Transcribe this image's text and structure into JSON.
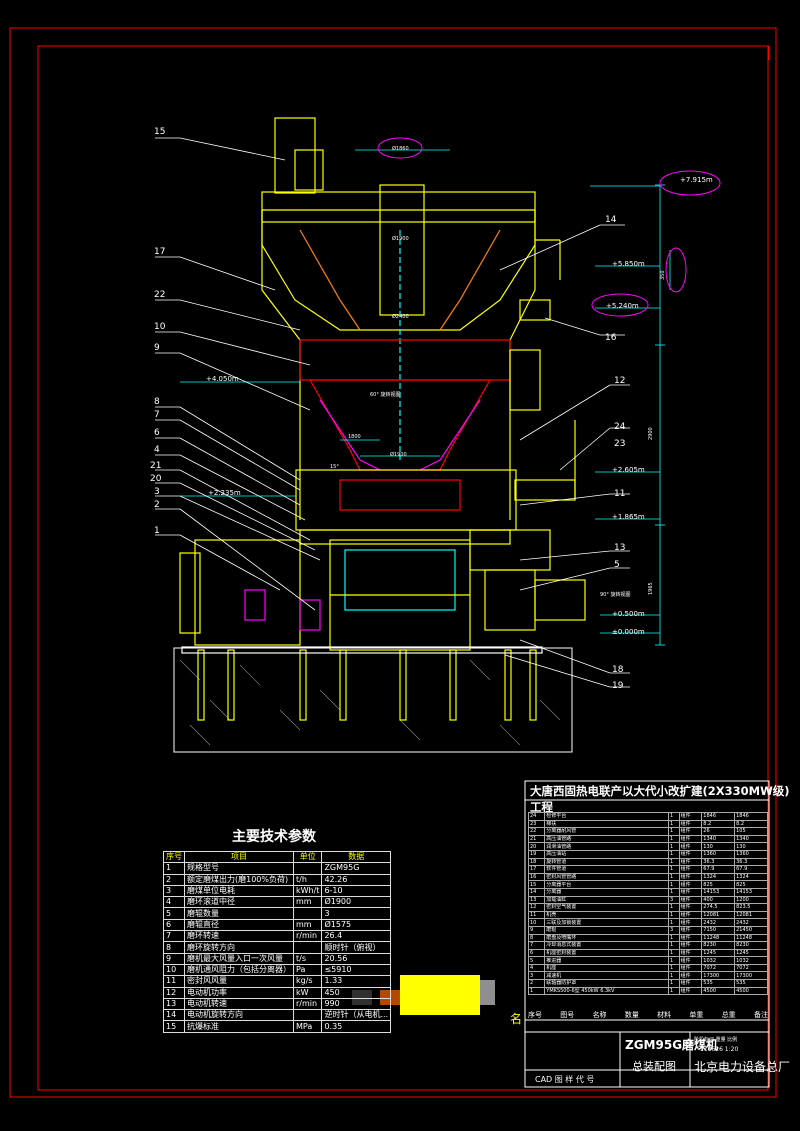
{
  "drawing": {
    "part_numbers": [
      "15",
      "17",
      "22",
      "10",
      "9",
      "8",
      "7",
      "6",
      "4",
      "21",
      "20",
      "3",
      "2",
      "1",
      "14",
      "16",
      "12",
      "24",
      "23",
      "11",
      "13",
      "5",
      "18",
      "19"
    ],
    "elevations": [
      "+7.915m",
      "+5.850m",
      "+5.240m",
      "+4.050m",
      "+2.605m",
      "+2.235m",
      "+1.865m",
      "+0.500m",
      "±0.000m"
    ],
    "dimensions": [
      "Ø1860",
      "Ø1900",
      "Ø1900",
      "1800",
      "2900",
      "1965",
      "350",
      "60° 旋转视图",
      "90° 旋转视图",
      "15°",
      "Ø2400"
    ],
    "colors": {
      "background": "#000000",
      "frame": "#ff0000",
      "body": "#ffff00",
      "dims": "#00ffff",
      "leaders": "#ffffff",
      "accent": "#ff00ff",
      "ground": "#ffffff"
    }
  },
  "params": {
    "title": "主要技术参数",
    "headers": [
      "序号",
      "项目",
      "单位",
      "数据"
    ],
    "rows": [
      [
        "1",
        "规格型号",
        "",
        "ZGM95G"
      ],
      [
        "2",
        "额定磨煤出力(磨100%负荷)",
        "t/h",
        "42.26"
      ],
      [
        "3",
        "磨煤单位电耗",
        "kWh/t",
        "6-10"
      ],
      [
        "4",
        "磨环滚道中径",
        "mm",
        "Ø1900"
      ],
      [
        "5",
        "磨辊数量",
        "",
        "3"
      ],
      [
        "6",
        "磨辊直径",
        "mm",
        "Ø1575"
      ],
      [
        "7",
        "磨环转速",
        "r/min",
        "26.4"
      ],
      [
        "8",
        "磨环旋转方向",
        "",
        "顺时针（俯视）"
      ],
      [
        "9",
        "磨机最大风量入口一次风量",
        "t/s",
        "20.56"
      ],
      [
        "10",
        "磨机通风阻力（包括分离器）",
        "Pa",
        "≤5910"
      ],
      [
        "11",
        "密封风风量",
        "kg/s",
        "1.33"
      ],
      [
        "12",
        "电动机功率",
        "kW",
        "450"
      ],
      [
        "13",
        "电动机转速",
        "r/min",
        "990"
      ],
      [
        "14",
        "电动机旋转方向",
        "",
        "逆时针（从电机..."
      ],
      [
        "15",
        "抗爆标准",
        "MPa",
        "0.35"
      ]
    ]
  },
  "bom": {
    "project_title": "大唐西固热电联产以大代小改扩建(2X330MW级)工程",
    "rows": [
      [
        "24",
        "检修平台",
        "1",
        "组件",
        "1846",
        "1846"
      ],
      [
        "23",
        "梯扶",
        "1",
        "组件",
        "8.2",
        "8.2"
      ],
      [
        "22",
        "分离器耐风管",
        "1",
        "组件",
        "26",
        "105"
      ],
      [
        "21",
        "高压油管路",
        "1",
        "组件",
        "1340",
        "1340"
      ],
      [
        "20",
        "润滑油管路",
        "1",
        "组件",
        "130",
        "130"
      ],
      [
        "19",
        "高压油站",
        "1",
        "组件",
        "1360",
        "1360"
      ],
      [
        "18",
        "旋转管道",
        "1",
        "组件",
        "36.3",
        "36.3"
      ],
      [
        "17",
        "软件管道",
        "1",
        "组件",
        "67.9",
        "67.9"
      ],
      [
        "16",
        "密封风管管路",
        "1",
        "组件",
        "1324",
        "1324"
      ],
      [
        "15",
        "分离器平台",
        "1",
        "组件",
        "825",
        "825"
      ],
      [
        "14",
        "分离器",
        "1",
        "组件",
        "14153",
        "14153"
      ],
      [
        "13",
        "加载油缸",
        "3",
        "组件",
        "400",
        "1200"
      ],
      [
        "12",
        "密封空气装置",
        "1",
        "组件",
        "274.5",
        "823.5"
      ],
      [
        "11",
        "机壳",
        "1",
        "组件",
        "12081",
        "12081"
      ],
      [
        "10",
        "三联及加锁装置",
        "1",
        "组件",
        "2432",
        "2432"
      ],
      [
        "9",
        "磨辊",
        "3",
        "组件",
        "7150",
        "21450"
      ],
      [
        "8",
        "磨盘及喷嘴环",
        "1",
        "组件",
        "11248",
        "11248"
      ],
      [
        "7",
        "冷却消息式装置",
        "1",
        "组件",
        "8230",
        "8230"
      ],
      [
        "6",
        "机座密封装置",
        "1",
        "组件",
        "1245",
        "1245"
      ],
      [
        "5",
        "推进器",
        "1",
        "组件",
        "1032",
        "1032"
      ],
      [
        "4",
        "机座",
        "1",
        "组件",
        "7072",
        "7072"
      ],
      [
        "3",
        "减速机",
        "1",
        "组件",
        "17300",
        "17300"
      ],
      [
        "2",
        "联轴器防护罩",
        "1",
        "组件",
        "535",
        "535"
      ],
      [
        "1",
        "YMKS500-6型 450kW 6.3kV",
        "1",
        "组件",
        "4500",
        "4500"
      ]
    ],
    "header": [
      "序号",
      "图号",
      "名称",
      "数量",
      "材料",
      "单重",
      "总重",
      "备注"
    ],
    "footer_label": "名",
    "title_machine": "ZGM95G磨煤机",
    "title_drawing": "总装配图",
    "company": "北京电力设备总厂",
    "cad_label": "CAD 图 样 代 号",
    "scale_label": "阶段标记 重量 比例",
    "scale_vals": "110626 1:20"
  }
}
